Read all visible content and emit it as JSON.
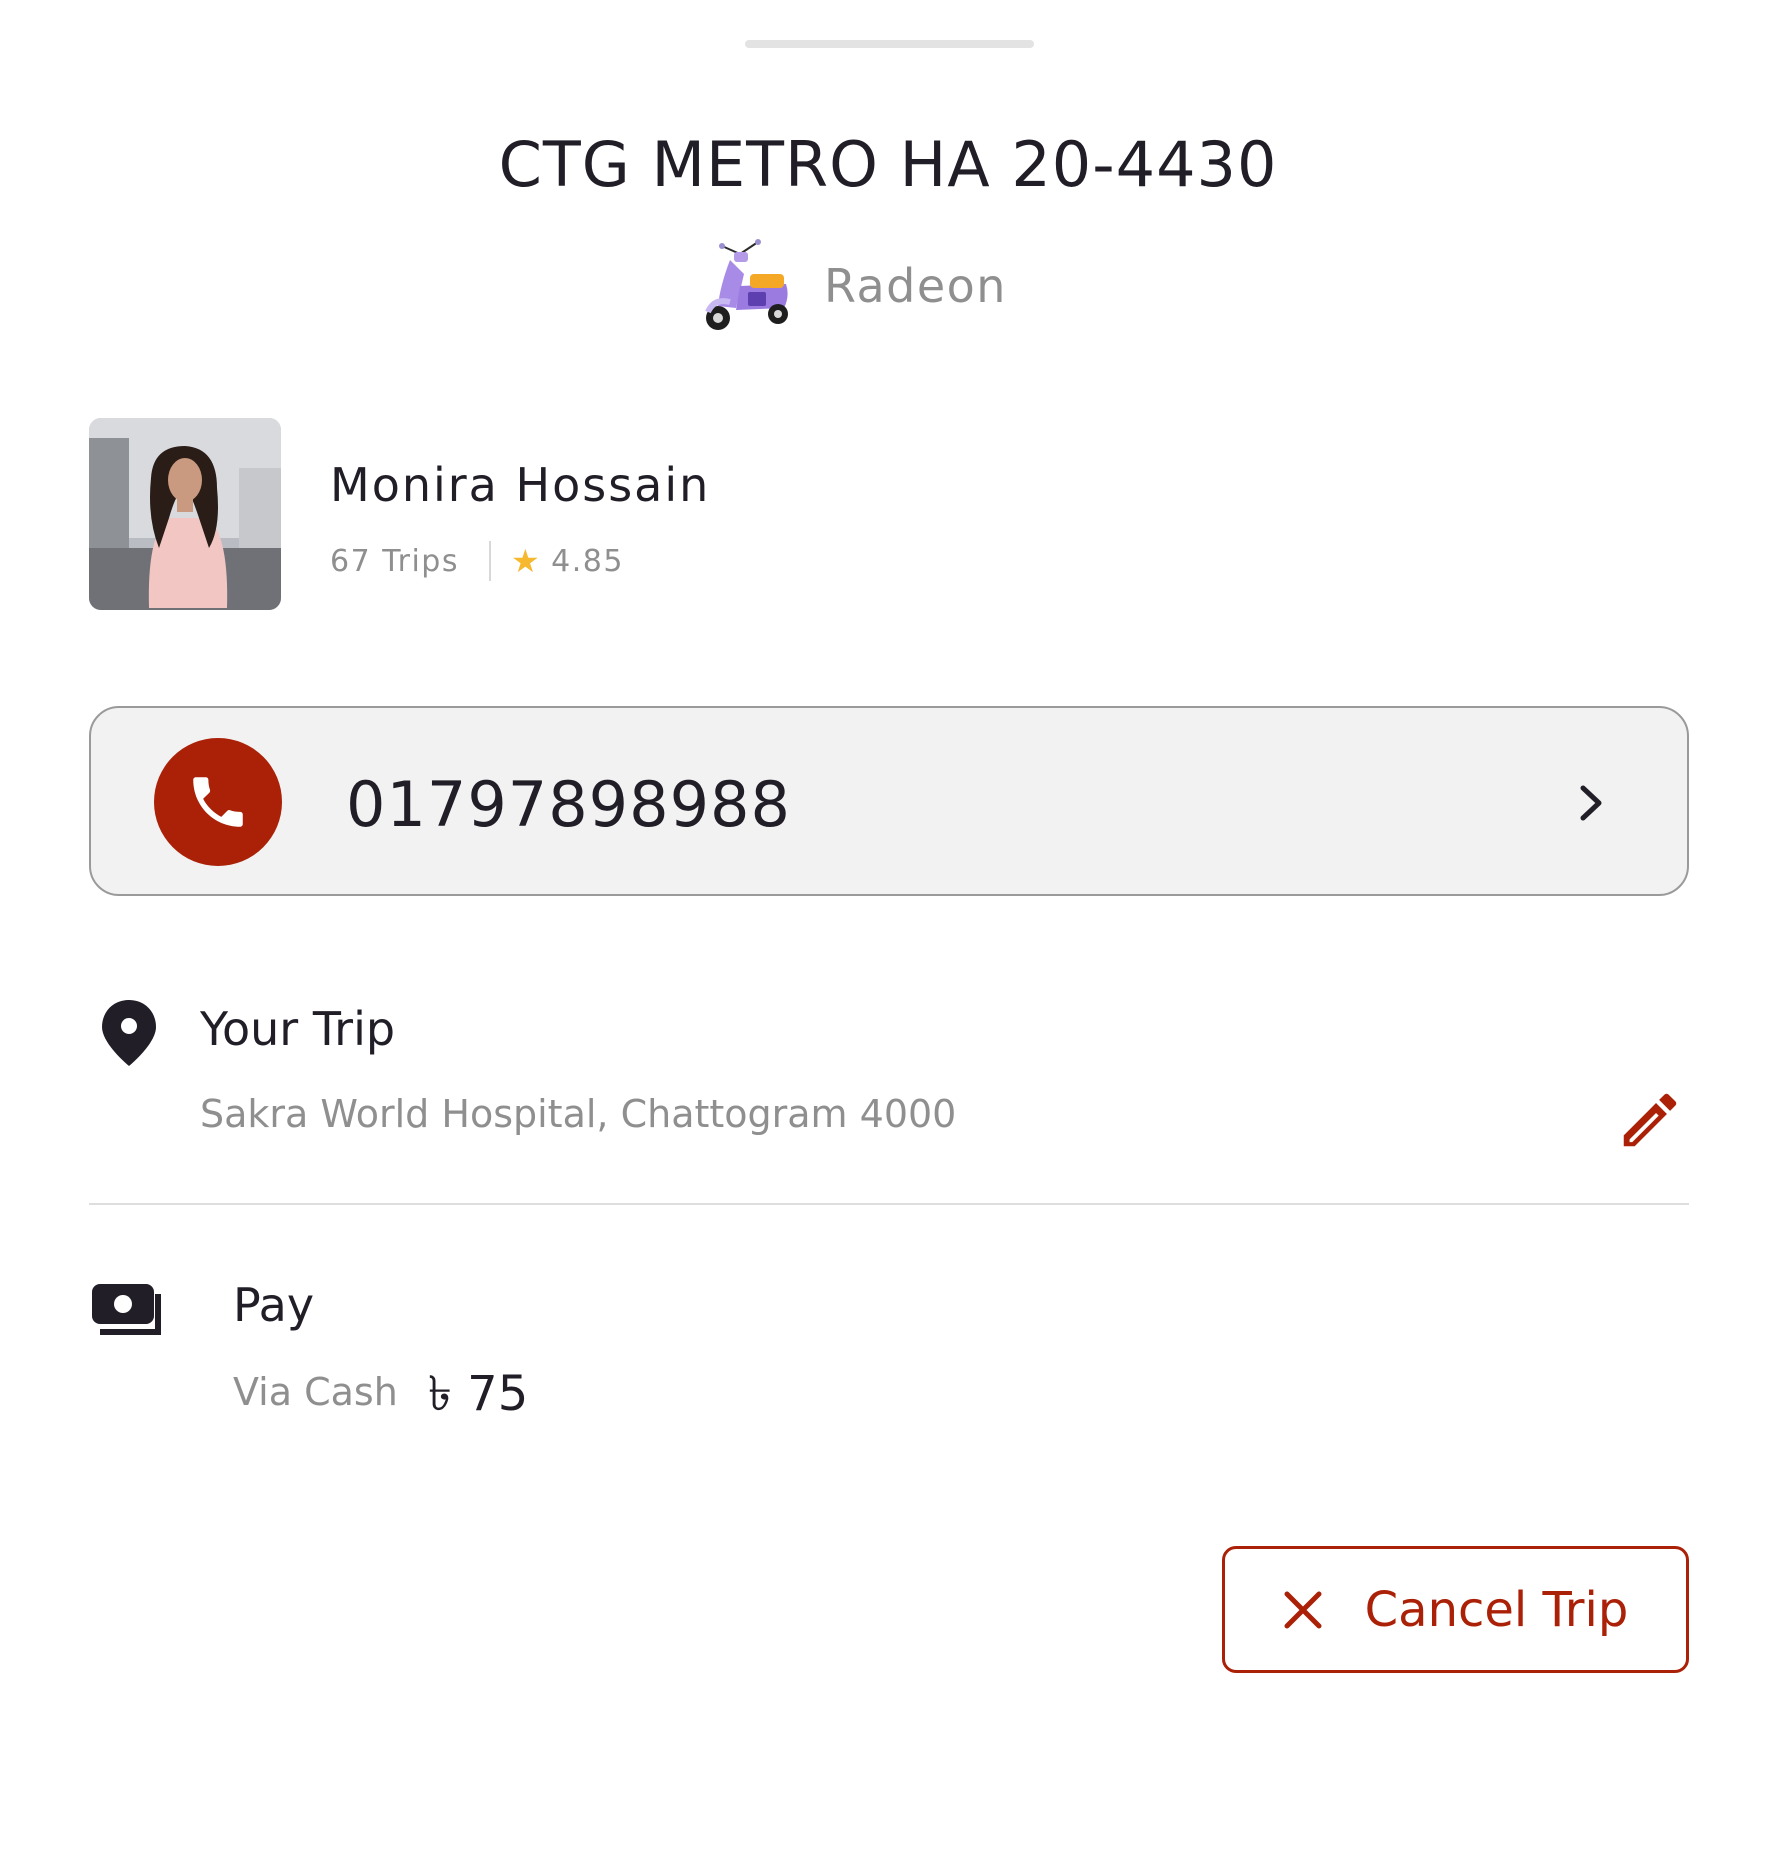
{
  "header": {
    "plate_number": "CTG METRO HA 20-4430",
    "vehicle_icon": "scooter-icon",
    "vehicle_name": "Radeon"
  },
  "driver": {
    "name": "Monira Hossain",
    "trips": "67 Trips",
    "rating": "4.85",
    "rating_icon": "star-icon"
  },
  "contact": {
    "phone_number": "01797898988",
    "call_icon": "phone-icon"
  },
  "trip": {
    "title": "Your Trip",
    "address": "Sakra World Hospital, Chattogram 4000"
  },
  "payment": {
    "title": "Pay",
    "method": "Via Cash",
    "amount": "৳ 75"
  },
  "actions": {
    "cancel_label": "Cancel Trip"
  },
  "colors": {
    "accent": "#aa2108",
    "text_primary": "#221e27",
    "text_secondary": "#8f8f8f",
    "star": "#f5b82e"
  }
}
